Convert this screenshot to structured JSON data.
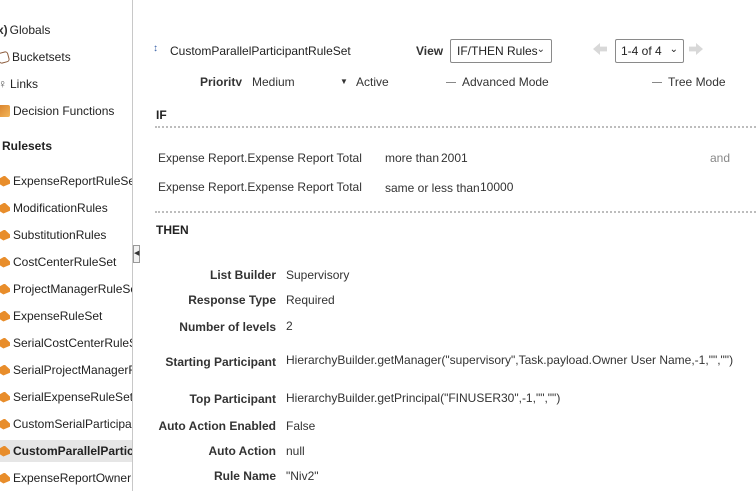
{
  "sidebar": {
    "items": [
      {
        "label": "Globals",
        "icon": "globals-icon"
      },
      {
        "label": "Bucketsets",
        "icon": "bucketset-icon"
      },
      {
        "label": "Links",
        "icon": "link-icon"
      },
      {
        "label": "Decision Functions",
        "icon": "decision-function-icon"
      }
    ],
    "rulesets_heading": "Rulesets",
    "rulesets": [
      "ExpenseReportRuleSet",
      "ModificationRules",
      "SubstitutionRules",
      "CostCenterRuleSet",
      "ProjectManagerRuleSet",
      "ExpenseRuleSet",
      "SerialCostCenterRuleSe",
      "SerialProjectManagerRu",
      "SerialExpenseRuleSet",
      "CustomSerialParticipant",
      "CustomParallelPartici",
      "ExpenseReportOwnerRu"
    ],
    "selected": "CustomParallelPartici"
  },
  "toolbar": {
    "title": "CustomParallelParticipantRuleSet",
    "view_label": "View",
    "view_value": "IF/THEN Rules",
    "pager_value": "1-4 of 4"
  },
  "options": {
    "priority_label": "Priority",
    "priority_value": "Medium",
    "active": "Active",
    "advanced_mode": "Advanced Mode",
    "tree_mode": "Tree Mode"
  },
  "if_section": {
    "label": "IF",
    "conditions": [
      {
        "left": "Expense Report.Expense Report Total",
        "operator": "more than",
        "value": "2001"
      },
      {
        "left": "Expense Report.Expense Report Total",
        "operator": "same or less than",
        "value": "10000"
      }
    ],
    "connector": "and"
  },
  "then_section": {
    "label": "THEN",
    "fields": {
      "list_builder": {
        "label": "List Builder",
        "value": "Supervisory"
      },
      "response_type": {
        "label": "Response Type",
        "value": "Required"
      },
      "number_of_levels": {
        "label": "Number of levels",
        "value": "2"
      },
      "starting_participant": {
        "label": "Starting Participant",
        "value": "HierarchyBuilder.getManager(\"supervisory\",Task.payload.Owner User Name,-1,\"\",\"\")"
      },
      "top_participant": {
        "label": "Top Participant",
        "value": "HierarchyBuilder.getPrincipal(\"FINUSER30\",-1,\"\",\"\")"
      },
      "auto_action_enabled": {
        "label": "Auto Action Enabled",
        "value": "False"
      },
      "auto_action": {
        "label": "Auto Action",
        "value": "null"
      },
      "rule_name": {
        "label": "Rule Name",
        "value": "\"Niv2\""
      }
    }
  },
  "colors": {
    "accent": "#3a63a8",
    "ruleset_icon": "#e88d2b",
    "selected_bg": "#e6e6e6"
  }
}
